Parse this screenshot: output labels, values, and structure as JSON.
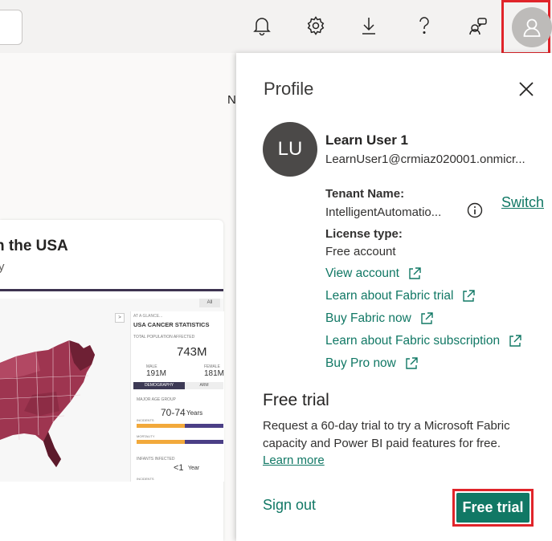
{
  "topbar": {
    "icons": [
      "bell-icon",
      "gear-icon",
      "download-icon",
      "help-icon",
      "share-feedback-icon",
      "person-icon"
    ]
  },
  "background": {
    "stray_letter": "N",
    "card": {
      "title": "n the USA",
      "subtitle": "y",
      "stats": {
        "all_label": "All",
        "arrow": ">",
        "at_a_glance": "AT A GLANCE...",
        "heading": "USA CANCER STATISTICS",
        "total_label": "TOTAL POPULATION AFFECTED",
        "total_value": "743M",
        "male_label": "MALE",
        "male_value": "191M",
        "female_label": "FEMALE",
        "female_value": "181M",
        "tab_demography": "DEMOGRAPHY",
        "tab_arm": "ARM",
        "major_age_label": "MAJOR AGE GROUP",
        "major_age_value": "70-74",
        "major_age_unit": "Years",
        "incidents_label": "INCIDENTS",
        "mortality_label": "MORTALITY",
        "infants_label": "INFANTS INFECTED",
        "infants_value": "<1",
        "infants_unit": "Year",
        "incidents_bottom": "INCIDENTS"
      }
    }
  },
  "panel": {
    "title": "Profile",
    "user": {
      "initials": "LU",
      "name": "Learn User 1",
      "email": "LearnUser1@crmiaz020001.onmicr..."
    },
    "tenant_label": "Tenant Name:",
    "tenant_value": "IntelligentAutomatio...",
    "switch_label": "Switch",
    "license_label": "License type:",
    "license_value": "Free account",
    "links": [
      "View account",
      "Learn about Fabric trial",
      "Buy Fabric now",
      "Learn about Fabric subscription",
      "Buy Pro now"
    ],
    "free_trial": {
      "heading": "Free trial",
      "description": "Request a 60-day trial to try a Microsoft Fabric capacity and Power BI paid features for free.",
      "learn_more": "Learn more",
      "button": "Free trial"
    },
    "sign_out": "Sign out"
  },
  "colors": {
    "accent": "#117865",
    "highlight": "#e0242a",
    "map_dark": "#7a2a3e"
  }
}
